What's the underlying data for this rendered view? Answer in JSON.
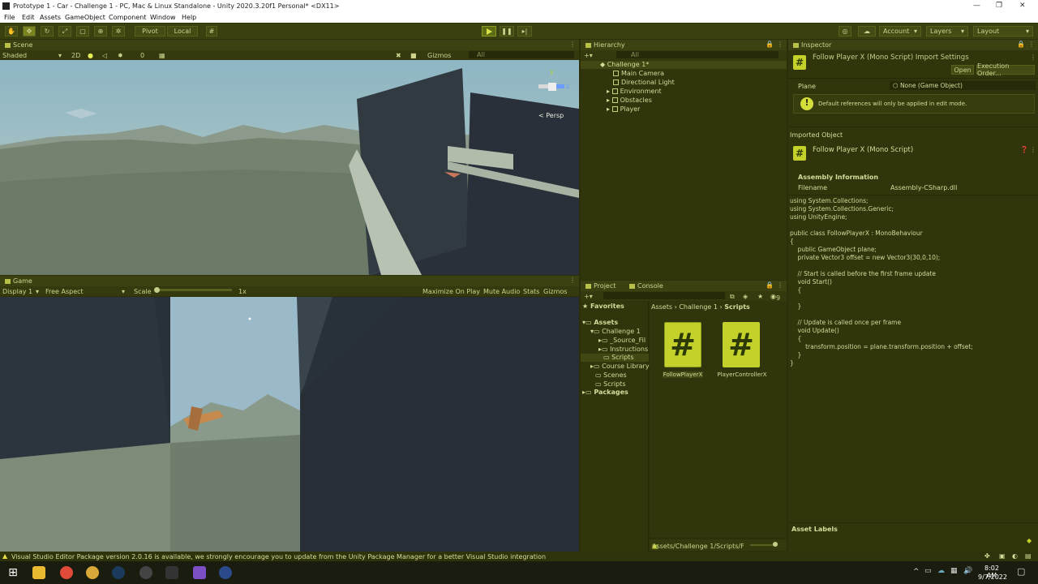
{
  "window": {
    "title": "Prototype 1 - Car - Challenge 1 - PC, Mac & Linux Standalone - Unity 2020.3.20f1 Personal* <DX11>"
  },
  "menu": [
    "File",
    "Edit",
    "Assets",
    "GameObject",
    "Component",
    "Window",
    "Help"
  ],
  "toolbar": {
    "pivot": "Pivot",
    "local": "Local",
    "account": "Account",
    "layers": "Layers",
    "layout": "Layout"
  },
  "scene": {
    "tab": "Scene",
    "shading": "Shaded",
    "mode2d": "2D",
    "fx_count": "0",
    "gizmos": "Gizmos",
    "search": "All",
    "persp": "< Persp",
    "axis_y": "y",
    "axis_z": "z"
  },
  "game": {
    "tab": "Game",
    "display": "Display 1",
    "aspect": "Free Aspect",
    "scale_label": "Scale",
    "scale_value": "1x",
    "maximize": "Maximize On Play",
    "mute": "Mute Audio",
    "stats": "Stats",
    "gizmos": "Gizmos"
  },
  "hierarchy": {
    "tab": "Hierarchy",
    "search": "All",
    "scene": "Challenge 1*",
    "items": [
      "Main Camera",
      "Directional Light",
      "Environment",
      "Obstacles",
      "Player"
    ]
  },
  "project": {
    "tab": "Project",
    "console_tab": "Console",
    "hidden_count": "9",
    "favorites": "Favorites",
    "assets_root": "Assets",
    "tree": [
      "Challenge 1",
      "_Source_Fil",
      "Instructions",
      "Scripts",
      "Course Library",
      "Scenes",
      "Scripts"
    ],
    "packages": "Packages",
    "breadcrumb": [
      "Assets",
      "Challenge 1",
      "Scripts"
    ],
    "files": [
      "FollowPlayerX",
      "PlayerControllerX"
    ],
    "path": "Assets/Challenge 1/Scripts/F"
  },
  "inspector": {
    "tab": "Inspector",
    "title": "Follow Player X (Mono Script) Import Settings",
    "open": "Open",
    "execution_order": "Execution Order...",
    "plane_label": "Plane",
    "plane_value": "None (Game Object)",
    "info": "Default references will only be applied in edit mode.",
    "imported_object": "Imported Object",
    "script_name": "Follow Player X (Mono Script)",
    "assembly_info": "Assembly Information",
    "filename_label": "Filename",
    "filename_value": "Assembly-CSharp.dll",
    "code": "using System.Collections;\nusing System.Collections.Generic;\nusing UnityEngine;\n\npublic class FollowPlayerX : MonoBehaviour\n{\n    public GameObject plane;\n    private Vector3 offset = new Vector3(30,0,10);\n\n    // Start is called before the first frame update\n    void Start()\n    {\n\n    }\n\n    // Update is called once per frame\n    void Update()\n    {\n        transform.position = plane.transform.position + offset;\n    }\n}",
    "asset_labels": "Asset Labels"
  },
  "status": {
    "message": "Visual Studio Editor Package version 2.0.16 is available, we strongly encourage you to update from the Unity Package Manager for a better Visual Studio integration"
  },
  "taskbar": {
    "time": "8:02 AM",
    "date": "9/7/2022"
  },
  "colors": {
    "accent": "#c4d12a",
    "panel": "#30350c",
    "tab": "#3c4111"
  }
}
